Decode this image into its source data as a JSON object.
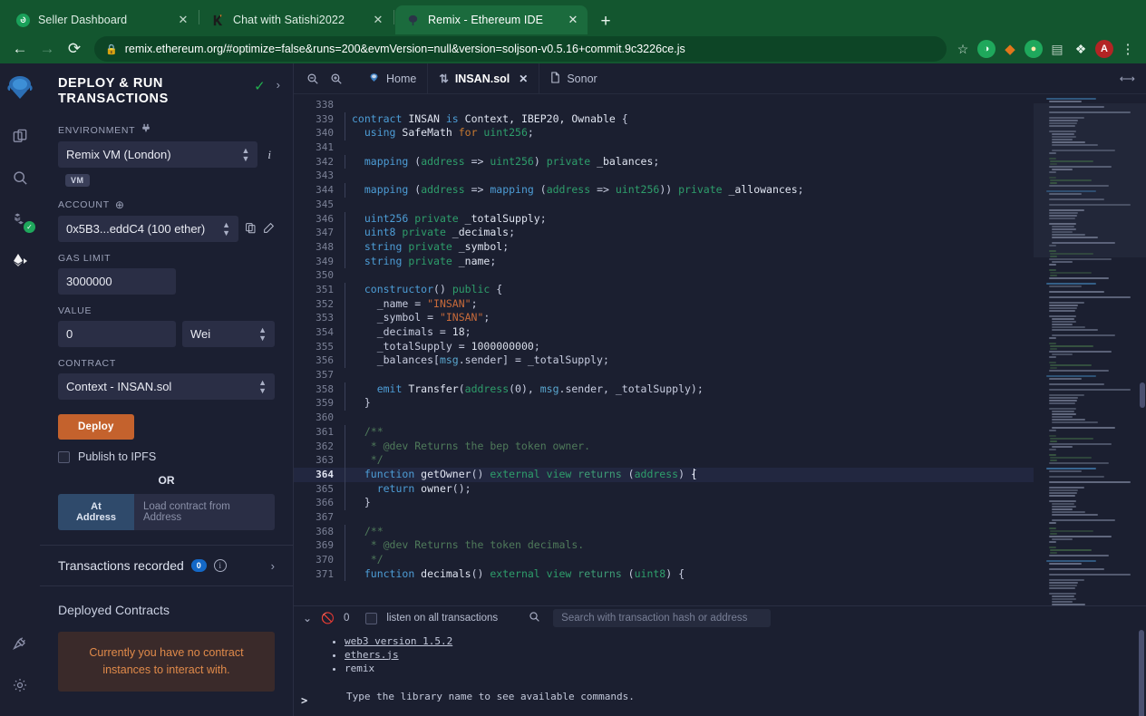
{
  "browser": {
    "tabs": [
      {
        "title": "Seller Dashboard",
        "favicon": "green-leaf-icon",
        "active": false
      },
      {
        "title": "Chat with Satishi2022",
        "favicon": "k-letter-icon",
        "active": false
      },
      {
        "title": "Remix - Ethereum IDE",
        "favicon": "remix-icon",
        "active": true
      }
    ],
    "newtab_label": "+",
    "nav": {
      "back": "←",
      "forward": "→",
      "reload": "⟳"
    },
    "url": "remix.ethereum.org/#optimize=false&runs=200&evmVersion=null&version=soljson-v0.5.16+commit.9c3226ce.js",
    "lock_icon": "lock-icon",
    "bookmark_icon": "star-icon",
    "extensions": [
      {
        "name": "green-circle-extension",
        "glyph": "◔",
        "color": "#1fa85c"
      },
      {
        "name": "metamask-fox-icon",
        "glyph": "◆",
        "color": "#e2761b"
      },
      {
        "name": "green-lightbulb-extension",
        "glyph": "●",
        "color": "#1fa85c"
      },
      {
        "name": "notes-extension",
        "glyph": "▤",
        "color": "#9fb7a8"
      },
      {
        "name": "puzzle-extensions-icon",
        "glyph": "❖",
        "color": "#dfeee5"
      },
      {
        "name": "profile-avatar",
        "glyph": "A",
        "color": "#b32424"
      },
      {
        "name": "chrome-menu-icon",
        "glyph": "⋮",
        "color": "#dfeee5"
      }
    ]
  },
  "rail": {
    "logo": "remix-logo",
    "items": [
      {
        "name": "file-explorer-icon",
        "active": false,
        "badge": null
      },
      {
        "name": "search-icon",
        "active": false,
        "badge": null
      },
      {
        "name": "solidity-compiler-icon",
        "active": false,
        "badge": "✓"
      },
      {
        "name": "deploy-run-icon",
        "active": true,
        "badge": null
      }
    ],
    "bottom": [
      {
        "name": "plugin-manager-icon"
      },
      {
        "name": "settings-gear-icon"
      }
    ]
  },
  "panel": {
    "title": "DEPLOY & RUN TRANSACTIONS",
    "check_icon": "✓",
    "caret_icon": "›",
    "environment_label": "ENVIRONMENT",
    "environment_value": "Remix VM (London)",
    "environment_plug_icon": "plug-icon",
    "environment_info_icon": "i",
    "vm_tag": "VM",
    "account_label": "ACCOUNT",
    "account_plus_icon": "⊕",
    "account_value": "0x5B3...eddC4 (100 ether)",
    "copy_icon": "copy-icon",
    "edit_icon": "edit-icon",
    "gas_limit_label": "GAS LIMIT",
    "gas_limit_value": "3000000",
    "value_label": "VALUE",
    "value_value": "0",
    "value_unit": "Wei",
    "contract_label": "CONTRACT",
    "contract_value": "Context - INSAN.sol",
    "deploy_label": "Deploy",
    "publish_ipfs_label": "Publish to IPFS",
    "or_label": "OR",
    "at_address_label": "At Address",
    "at_address_placeholder": "Load contract from Address",
    "transactions_recorded_label": "Transactions recorded",
    "transactions_recorded_count": "0",
    "deployed_contracts_label": "Deployed Contracts",
    "no_contracts_message": "Currently you have no contract instances to interact with.",
    "deploy_button_color": "#c4622d"
  },
  "editor": {
    "zoom_out_icon": "zoom-out-icon",
    "zoom_in_icon": "zoom-in-icon",
    "tabs": [
      {
        "label": "Home",
        "icon": "remix-home-icon",
        "active": false,
        "closable": false
      },
      {
        "label": "INSAN.sol",
        "icon": "solidity-file-icon",
        "active": true,
        "closable": true
      },
      {
        "label": "Sonor",
        "icon": "file-icon",
        "active": false,
        "closable": false
      }
    ],
    "close_icon": "✕",
    "resize_handle_icon": "resize-horizontal-icon",
    "current_line": 364,
    "lines": [
      {
        "n": 338,
        "tokens": []
      },
      {
        "n": 339,
        "tokens": [
          [
            "k",
            "contract "
          ],
          [
            "fn",
            "INSAN "
          ],
          [
            "k",
            "is "
          ],
          [
            "fn",
            "Context, IBEP20, Ownable "
          ],
          [
            "pn",
            "{"
          ]
        ]
      },
      {
        "n": 340,
        "tokens": [
          [
            "pn",
            "  "
          ],
          [
            "k",
            "using "
          ],
          [
            "fn",
            "SafeMath "
          ],
          [
            "k2",
            "for "
          ],
          [
            "ty",
            "uint256"
          ],
          [
            "pn",
            ";"
          ]
        ]
      },
      {
        "n": 341,
        "tokens": []
      },
      {
        "n": 342,
        "tokens": [
          [
            "pn",
            "  "
          ],
          [
            "k",
            "mapping "
          ],
          [
            "pn",
            "("
          ],
          [
            "ty",
            "address"
          ],
          [
            "pn",
            " => "
          ],
          [
            "ty",
            "uint256"
          ],
          [
            "pn",
            ") "
          ],
          [
            "ty",
            "private "
          ],
          [
            "fn",
            "_balances"
          ],
          [
            "pn",
            ";"
          ]
        ]
      },
      {
        "n": 343,
        "tokens": []
      },
      {
        "n": 344,
        "tokens": [
          [
            "pn",
            "  "
          ],
          [
            "k",
            "mapping "
          ],
          [
            "pn",
            "("
          ],
          [
            "ty",
            "address"
          ],
          [
            "pn",
            " => "
          ],
          [
            "k",
            "mapping "
          ],
          [
            "pn",
            "("
          ],
          [
            "ty",
            "address"
          ],
          [
            "pn",
            " => "
          ],
          [
            "ty",
            "uint256"
          ],
          [
            "pn",
            ")) "
          ],
          [
            "ty",
            "private "
          ],
          [
            "fn",
            "_allowances"
          ],
          [
            "pn",
            ";"
          ]
        ]
      },
      {
        "n": 345,
        "tokens": []
      },
      {
        "n": 346,
        "tokens": [
          [
            "pn",
            "  "
          ],
          [
            "k",
            "uint256 "
          ],
          [
            "ty",
            "private "
          ],
          [
            "fn",
            "_totalSupply"
          ],
          [
            "pn",
            ";"
          ]
        ]
      },
      {
        "n": 347,
        "tokens": [
          [
            "pn",
            "  "
          ],
          [
            "k",
            "uint8 "
          ],
          [
            "ty",
            "private "
          ],
          [
            "fn",
            "_decimals"
          ],
          [
            "pn",
            ";"
          ]
        ]
      },
      {
        "n": 348,
        "tokens": [
          [
            "pn",
            "  "
          ],
          [
            "k",
            "string "
          ],
          [
            "ty",
            "private "
          ],
          [
            "fn",
            "_symbol"
          ],
          [
            "pn",
            ";"
          ]
        ]
      },
      {
        "n": 349,
        "tokens": [
          [
            "pn",
            "  "
          ],
          [
            "k",
            "string "
          ],
          [
            "ty",
            "private "
          ],
          [
            "fn",
            "_name"
          ],
          [
            "pn",
            ";"
          ]
        ]
      },
      {
        "n": 350,
        "tokens": []
      },
      {
        "n": 351,
        "tokens": [
          [
            "pn",
            "  "
          ],
          [
            "k",
            "constructor"
          ],
          [
            "pn",
            "() "
          ],
          [
            "ty",
            "public "
          ],
          [
            "pn",
            "{"
          ]
        ]
      },
      {
        "n": 352,
        "tokens": [
          [
            "pn",
            "    _name = "
          ],
          [
            "str",
            "\"INSAN\""
          ],
          [
            "pn",
            ";"
          ]
        ]
      },
      {
        "n": 353,
        "tokens": [
          [
            "pn",
            "    _symbol = "
          ],
          [
            "str",
            "\"INSAN\""
          ],
          [
            "pn",
            ";"
          ]
        ]
      },
      {
        "n": 354,
        "tokens": [
          [
            "pn",
            "    _decimals = "
          ],
          [
            "num",
            "18"
          ],
          [
            "pn",
            ";"
          ]
        ]
      },
      {
        "n": 355,
        "tokens": [
          [
            "pn",
            "    _totalSupply = "
          ],
          [
            "num",
            "1000000000"
          ],
          [
            "pn",
            ";"
          ]
        ]
      },
      {
        "n": 356,
        "tokens": [
          [
            "pn",
            "    _balances["
          ],
          [
            "gl",
            "msg"
          ],
          [
            "pn",
            ".sender] = _totalSupply;"
          ]
        ]
      },
      {
        "n": 357,
        "tokens": []
      },
      {
        "n": 358,
        "tokens": [
          [
            "pn",
            "    "
          ],
          [
            "k",
            "emit "
          ],
          [
            "fn",
            "Transfer"
          ],
          [
            "pn",
            "("
          ],
          [
            "ty",
            "address"
          ],
          [
            "pn",
            "(0), "
          ],
          [
            "gl",
            "msg"
          ],
          [
            "pn",
            ".sender, _totalSupply);"
          ]
        ]
      },
      {
        "n": 359,
        "tokens": [
          [
            "pn",
            "  }"
          ]
        ]
      },
      {
        "n": 360,
        "tokens": []
      },
      {
        "n": 361,
        "tokens": [
          [
            "cm",
            "  /**"
          ]
        ]
      },
      {
        "n": 362,
        "tokens": [
          [
            "cm",
            "   * @dev Returns the bep token owner."
          ]
        ]
      },
      {
        "n": 363,
        "tokens": [
          [
            "cm",
            "   */"
          ]
        ]
      },
      {
        "n": 364,
        "tokens": [
          [
            "pn",
            "  "
          ],
          [
            "k",
            "function "
          ],
          [
            "fn",
            "getOwner"
          ],
          [
            "pn",
            "() "
          ],
          [
            "ty",
            "external view "
          ],
          [
            "ret",
            "returns "
          ],
          [
            "pn",
            "("
          ],
          [
            "ty",
            "address"
          ],
          [
            "pn",
            ") {"
          ]
        ]
      },
      {
        "n": 365,
        "tokens": [
          [
            "pn",
            "    "
          ],
          [
            "k",
            "return "
          ],
          [
            "fn",
            "owner"
          ],
          [
            "pn",
            "();"
          ]
        ]
      },
      {
        "n": 366,
        "tokens": [
          [
            "pn",
            "  }"
          ]
        ]
      },
      {
        "n": 367,
        "tokens": []
      },
      {
        "n": 368,
        "tokens": [
          [
            "cm",
            "  /**"
          ]
        ]
      },
      {
        "n": 369,
        "tokens": [
          [
            "cm",
            "   * @dev Returns the token decimals."
          ]
        ]
      },
      {
        "n": 370,
        "tokens": [
          [
            "cm",
            "   */"
          ]
        ]
      },
      {
        "n": 371,
        "tokens": [
          [
            "pn",
            "  "
          ],
          [
            "k",
            "function "
          ],
          [
            "fn",
            "decimals"
          ],
          [
            "pn",
            "() "
          ],
          [
            "ty",
            "external view "
          ],
          [
            "ret",
            "returns "
          ],
          [
            "pn",
            "("
          ],
          [
            "ty",
            "uint8"
          ],
          [
            "pn",
            ") {"
          ]
        ]
      }
    ]
  },
  "terminal": {
    "collapse_icon": "chevron-double-down-icon",
    "clear_icon": "no-entry-icon",
    "pending_count": "0",
    "listen_label": "listen on all transactions",
    "search_icon": "search-icon",
    "search_placeholder": "Search with transaction hash or address",
    "items": [
      {
        "text": "web3 version 1.5.2",
        "link": true
      },
      {
        "text": "ethers.js",
        "link": true
      },
      {
        "text": "remix",
        "link": false
      }
    ],
    "note": "Type the library name to see available commands.",
    "prompt": ">"
  }
}
